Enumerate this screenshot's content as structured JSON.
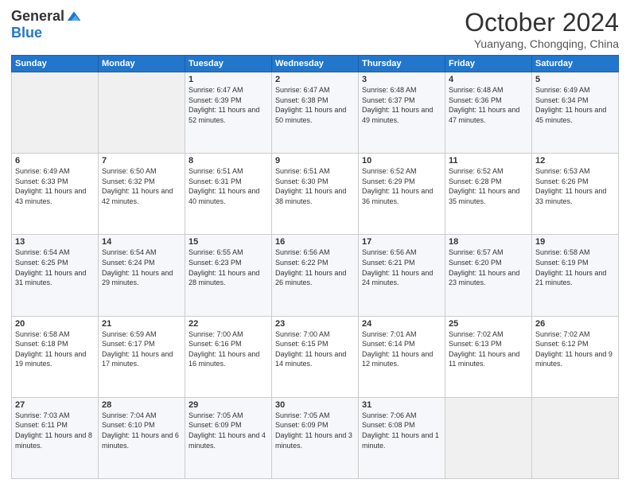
{
  "header": {
    "logo_general": "General",
    "logo_blue": "Blue",
    "month": "October 2024",
    "location": "Yuanyang, Chongqing, China"
  },
  "weekdays": [
    "Sunday",
    "Monday",
    "Tuesday",
    "Wednesday",
    "Thursday",
    "Friday",
    "Saturday"
  ],
  "weeks": [
    [
      {
        "day": "",
        "info": ""
      },
      {
        "day": "",
        "info": ""
      },
      {
        "day": "1",
        "info": "Sunrise: 6:47 AM\nSunset: 6:39 PM\nDaylight: 11 hours and 52 minutes."
      },
      {
        "day": "2",
        "info": "Sunrise: 6:47 AM\nSunset: 6:38 PM\nDaylight: 11 hours and 50 minutes."
      },
      {
        "day": "3",
        "info": "Sunrise: 6:48 AM\nSunset: 6:37 PM\nDaylight: 11 hours and 49 minutes."
      },
      {
        "day": "4",
        "info": "Sunrise: 6:48 AM\nSunset: 6:36 PM\nDaylight: 11 hours and 47 minutes."
      },
      {
        "day": "5",
        "info": "Sunrise: 6:49 AM\nSunset: 6:34 PM\nDaylight: 11 hours and 45 minutes."
      }
    ],
    [
      {
        "day": "6",
        "info": "Sunrise: 6:49 AM\nSunset: 6:33 PM\nDaylight: 11 hours and 43 minutes."
      },
      {
        "day": "7",
        "info": "Sunrise: 6:50 AM\nSunset: 6:32 PM\nDaylight: 11 hours and 42 minutes."
      },
      {
        "day": "8",
        "info": "Sunrise: 6:51 AM\nSunset: 6:31 PM\nDaylight: 11 hours and 40 minutes."
      },
      {
        "day": "9",
        "info": "Sunrise: 6:51 AM\nSunset: 6:30 PM\nDaylight: 11 hours and 38 minutes."
      },
      {
        "day": "10",
        "info": "Sunrise: 6:52 AM\nSunset: 6:29 PM\nDaylight: 11 hours and 36 minutes."
      },
      {
        "day": "11",
        "info": "Sunrise: 6:52 AM\nSunset: 6:28 PM\nDaylight: 11 hours and 35 minutes."
      },
      {
        "day": "12",
        "info": "Sunrise: 6:53 AM\nSunset: 6:26 PM\nDaylight: 11 hours and 33 minutes."
      }
    ],
    [
      {
        "day": "13",
        "info": "Sunrise: 6:54 AM\nSunset: 6:25 PM\nDaylight: 11 hours and 31 minutes."
      },
      {
        "day": "14",
        "info": "Sunrise: 6:54 AM\nSunset: 6:24 PM\nDaylight: 11 hours and 29 minutes."
      },
      {
        "day": "15",
        "info": "Sunrise: 6:55 AM\nSunset: 6:23 PM\nDaylight: 11 hours and 28 minutes."
      },
      {
        "day": "16",
        "info": "Sunrise: 6:56 AM\nSunset: 6:22 PM\nDaylight: 11 hours and 26 minutes."
      },
      {
        "day": "17",
        "info": "Sunrise: 6:56 AM\nSunset: 6:21 PM\nDaylight: 11 hours and 24 minutes."
      },
      {
        "day": "18",
        "info": "Sunrise: 6:57 AM\nSunset: 6:20 PM\nDaylight: 11 hours and 23 minutes."
      },
      {
        "day": "19",
        "info": "Sunrise: 6:58 AM\nSunset: 6:19 PM\nDaylight: 11 hours and 21 minutes."
      }
    ],
    [
      {
        "day": "20",
        "info": "Sunrise: 6:58 AM\nSunset: 6:18 PM\nDaylight: 11 hours and 19 minutes."
      },
      {
        "day": "21",
        "info": "Sunrise: 6:59 AM\nSunset: 6:17 PM\nDaylight: 11 hours and 17 minutes."
      },
      {
        "day": "22",
        "info": "Sunrise: 7:00 AM\nSunset: 6:16 PM\nDaylight: 11 hours and 16 minutes."
      },
      {
        "day": "23",
        "info": "Sunrise: 7:00 AM\nSunset: 6:15 PM\nDaylight: 11 hours and 14 minutes."
      },
      {
        "day": "24",
        "info": "Sunrise: 7:01 AM\nSunset: 6:14 PM\nDaylight: 11 hours and 12 minutes."
      },
      {
        "day": "25",
        "info": "Sunrise: 7:02 AM\nSunset: 6:13 PM\nDaylight: 11 hours and 11 minutes."
      },
      {
        "day": "26",
        "info": "Sunrise: 7:02 AM\nSunset: 6:12 PM\nDaylight: 11 hours and 9 minutes."
      }
    ],
    [
      {
        "day": "27",
        "info": "Sunrise: 7:03 AM\nSunset: 6:11 PM\nDaylight: 11 hours and 8 minutes."
      },
      {
        "day": "28",
        "info": "Sunrise: 7:04 AM\nSunset: 6:10 PM\nDaylight: 11 hours and 6 minutes."
      },
      {
        "day": "29",
        "info": "Sunrise: 7:05 AM\nSunset: 6:09 PM\nDaylight: 11 hours and 4 minutes."
      },
      {
        "day": "30",
        "info": "Sunrise: 7:05 AM\nSunset: 6:09 PM\nDaylight: 11 hours and 3 minutes."
      },
      {
        "day": "31",
        "info": "Sunrise: 7:06 AM\nSunset: 6:08 PM\nDaylight: 11 hours and 1 minute."
      },
      {
        "day": "",
        "info": ""
      },
      {
        "day": "",
        "info": ""
      }
    ]
  ]
}
